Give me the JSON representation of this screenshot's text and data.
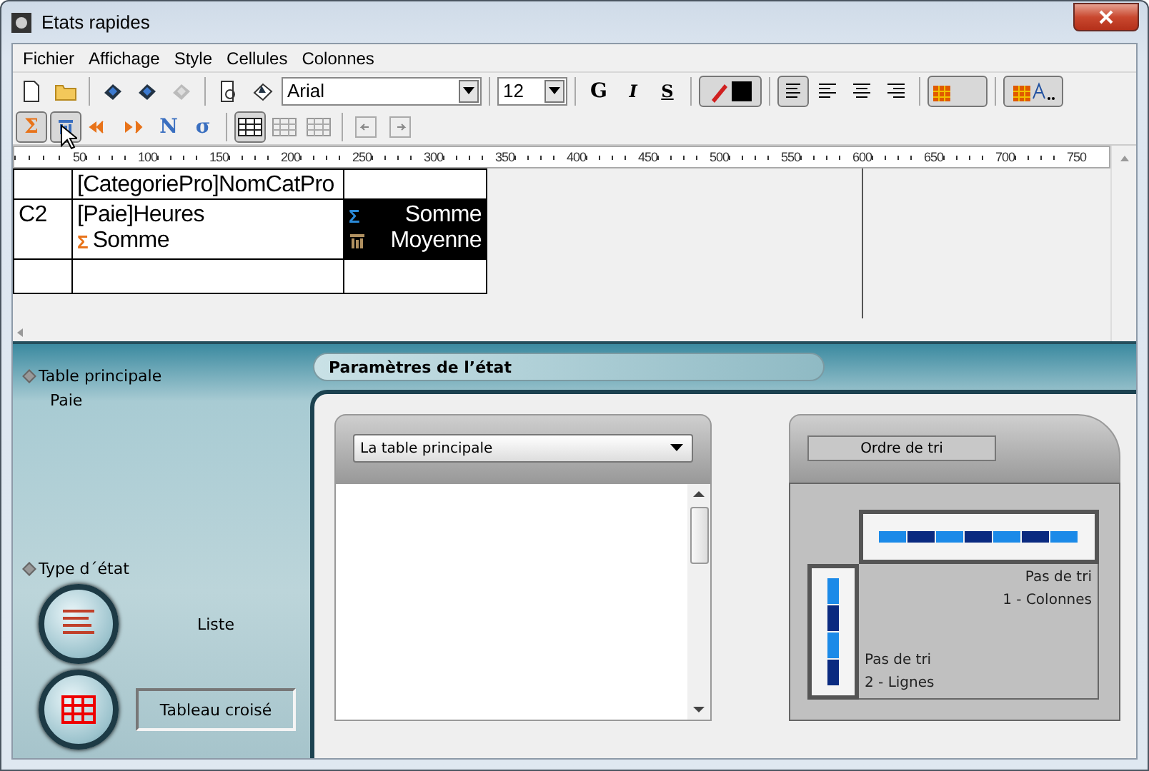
{
  "window": {
    "title": "Etats rapides"
  },
  "menu": [
    "Fichier",
    "Affichage",
    "Style",
    "Cellules",
    "Colonnes"
  ],
  "toolbar": {
    "font": "Arial",
    "size": "12",
    "text_styles": [
      {
        "kind": "bold",
        "label": "G"
      },
      {
        "kind": "italic",
        "label": "I"
      },
      {
        "kind": "underline",
        "label": "S"
      }
    ],
    "align": [
      {
        "selected": true
      },
      {
        "selected": false
      },
      {
        "selected": false
      },
      {
        "selected": false
      }
    ],
    "save_buttons": [
      {
        "disabled": false
      },
      {
        "disabled": false
      },
      {
        "disabled": true
      }
    ]
  },
  "functions": [
    {
      "kind": "symbol",
      "symbol": "Σ",
      "selected": true
    },
    {
      "kind": "mean",
      "selected": true
    },
    {
      "kind": "left-arrows",
      "selected": false
    },
    {
      "kind": "right-arrows",
      "selected": false
    },
    {
      "kind": "symbol",
      "symbol": "N",
      "selected": false
    },
    {
      "kind": "symbol",
      "symbol": "σ",
      "selected": false
    }
  ],
  "layouts": [
    {
      "selected": true
    },
    {
      "selected": false
    },
    {
      "selected": false
    }
  ],
  "ruler": [
    "50",
    "100",
    "150",
    "200",
    "250",
    "300",
    "350",
    "400",
    "450",
    "500",
    "550",
    "600",
    "650",
    "700",
    "750"
  ],
  "grid": {
    "rows": [
      {
        "cells": [
          {},
          {
            "lines": [
              {
                "text": "[CategoriePro]NomCatPro"
              }
            ]
          },
          {}
        ]
      },
      {
        "cells": [
          {
            "lines": [
              {
                "text": "C2"
              }
            ]
          },
          {
            "lines": [
              {
                "text": "[Paie]Heures"
              },
              {
                "kind": "sum",
                "symbol": "Σ",
                "text": "Somme"
              }
            ]
          },
          {
            "inverted": true,
            "lines": [
              {
                "kind": "sum",
                "symbol": "Σ",
                "text": "Somme"
              },
              {
                "kind": "mean",
                "text": "Moyenne"
              }
            ]
          }
        ]
      },
      {
        "cells": [
          {},
          {},
          {}
        ]
      }
    ]
  },
  "sidebar": {
    "main_table_label": "Table principale",
    "main_table": "Paie",
    "type_label": "Type d´état",
    "types": [
      {
        "kind": "list",
        "label": "Liste",
        "selected": false
      },
      {
        "kind": "grid",
        "label": "Tableau croisé",
        "selected": true
      }
    ]
  },
  "parameters": {
    "title": "Paramètres de l’état",
    "table_select": "La table principale",
    "sort": {
      "tab": "Ordre de tri",
      "columns": [
        "Pas de tri",
        "1 - Colonnes"
      ],
      "rows": [
        "Pas de tri",
        "2 - Lignes"
      ]
    }
  }
}
